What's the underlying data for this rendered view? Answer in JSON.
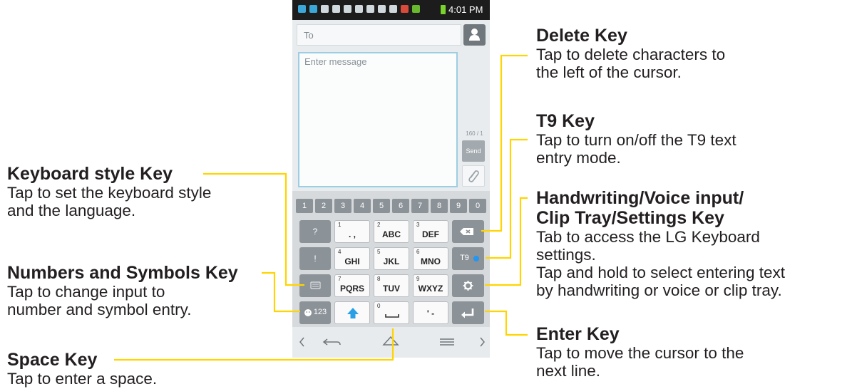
{
  "status_bar": {
    "time": "4:01 PM"
  },
  "compose": {
    "to_placeholder": "To",
    "message_placeholder": "Enter message",
    "char_counter": "160 / 1",
    "send_label": "Send"
  },
  "keyboard": {
    "number_row": [
      "1",
      "2",
      "3",
      "4",
      "5",
      "6",
      "7",
      "8",
      "9",
      "0"
    ],
    "keys": {
      "question": "?",
      "exclaim": "!",
      "k1_num": "1",
      "k1_label": ". ,",
      "k2_num": "2",
      "k2_label": "ABC",
      "k3_num": "3",
      "k3_label": "DEF",
      "k4_num": "4",
      "k4_label": "GHI",
      "k5_num": "5",
      "k5_label": "JKL",
      "k6_num": "6",
      "k6_label": "MNO",
      "k7_num": "7",
      "k7_label": "PQRS",
      "k8_num": "8",
      "k8_label": "TUV",
      "k9_num": "9",
      "k9_label": "WXYZ",
      "k0_num": "0",
      "punct": "' -",
      "t9": "T9",
      "num_sym": "123"
    }
  },
  "annotations": {
    "delete": {
      "title": "Delete Key",
      "desc": "Tap to delete characters to\nthe left of the cursor."
    },
    "t9": {
      "title": "T9 Key",
      "desc": "Tap to turn on/off the T9 text\nentry mode."
    },
    "handwriting": {
      "title": "Handwriting/Voice input/\nClip Tray/Settings Key",
      "desc": "Tab to access the LG Keyboard\nsettings.\nTap and hold to select entering text\nby handwriting or voice or clip tray."
    },
    "enter": {
      "title": "Enter Key",
      "desc": "Tap to move the cursor to the\nnext line."
    },
    "keyboard_style": {
      "title": "Keyboard style Key",
      "desc": "Tap to set the keyboard style\nand the  language."
    },
    "numbers_symbols": {
      "title": "Numbers and Symbols Key",
      "desc": "Tap to change input to\nnumber and symbol entry."
    },
    "space": {
      "title": "Space Key",
      "desc": "Tap to enter a space."
    }
  },
  "colors": {
    "leader": "#ffd400",
    "accent": "#2196f3"
  }
}
